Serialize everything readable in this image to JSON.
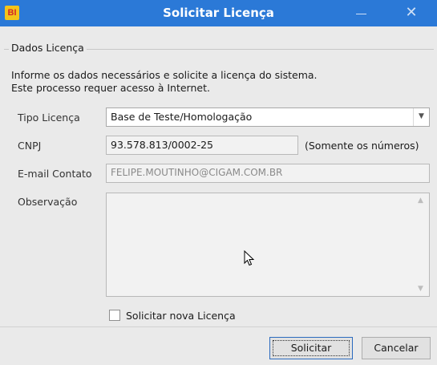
{
  "window": {
    "title": "Solicitar Licença",
    "app_icon_text": "BI",
    "close_glyph": "✕"
  },
  "group": {
    "legend": "Dados Licença",
    "intro_line1": "Informe os dados necessários e solicite a licença do sistema.",
    "intro_line2": "Este processo requer acesso à Internet."
  },
  "form": {
    "tipo_licenca_label": "Tipo Licença",
    "tipo_licenca_value": "Base de Teste/Homologação",
    "cnpj_label": "CNPJ",
    "cnpj_value": "93.578.813/0002-25",
    "cnpj_hint": "(Somente os números)",
    "email_label": "E-mail Contato",
    "email_value": "FELIPE.MOUTINHO@CIGAM.COM.BR",
    "observacao_label": "Observação",
    "observacao_value": "",
    "checkbox_label": "Solicitar nova Licença"
  },
  "buttons": {
    "solicitar": "Solicitar",
    "cancelar": "Cancelar"
  },
  "colors": {
    "titlebar": "#2b79d7",
    "app_icon_bg": "#f3c419",
    "app_icon_text": "#d2262a"
  },
  "icons": {
    "app": "bi-app-icon",
    "minimize": "minimize-icon",
    "close": "close-icon",
    "dropdown": "chevron-down-icon",
    "cursor": "mouse-pointer-icon"
  }
}
